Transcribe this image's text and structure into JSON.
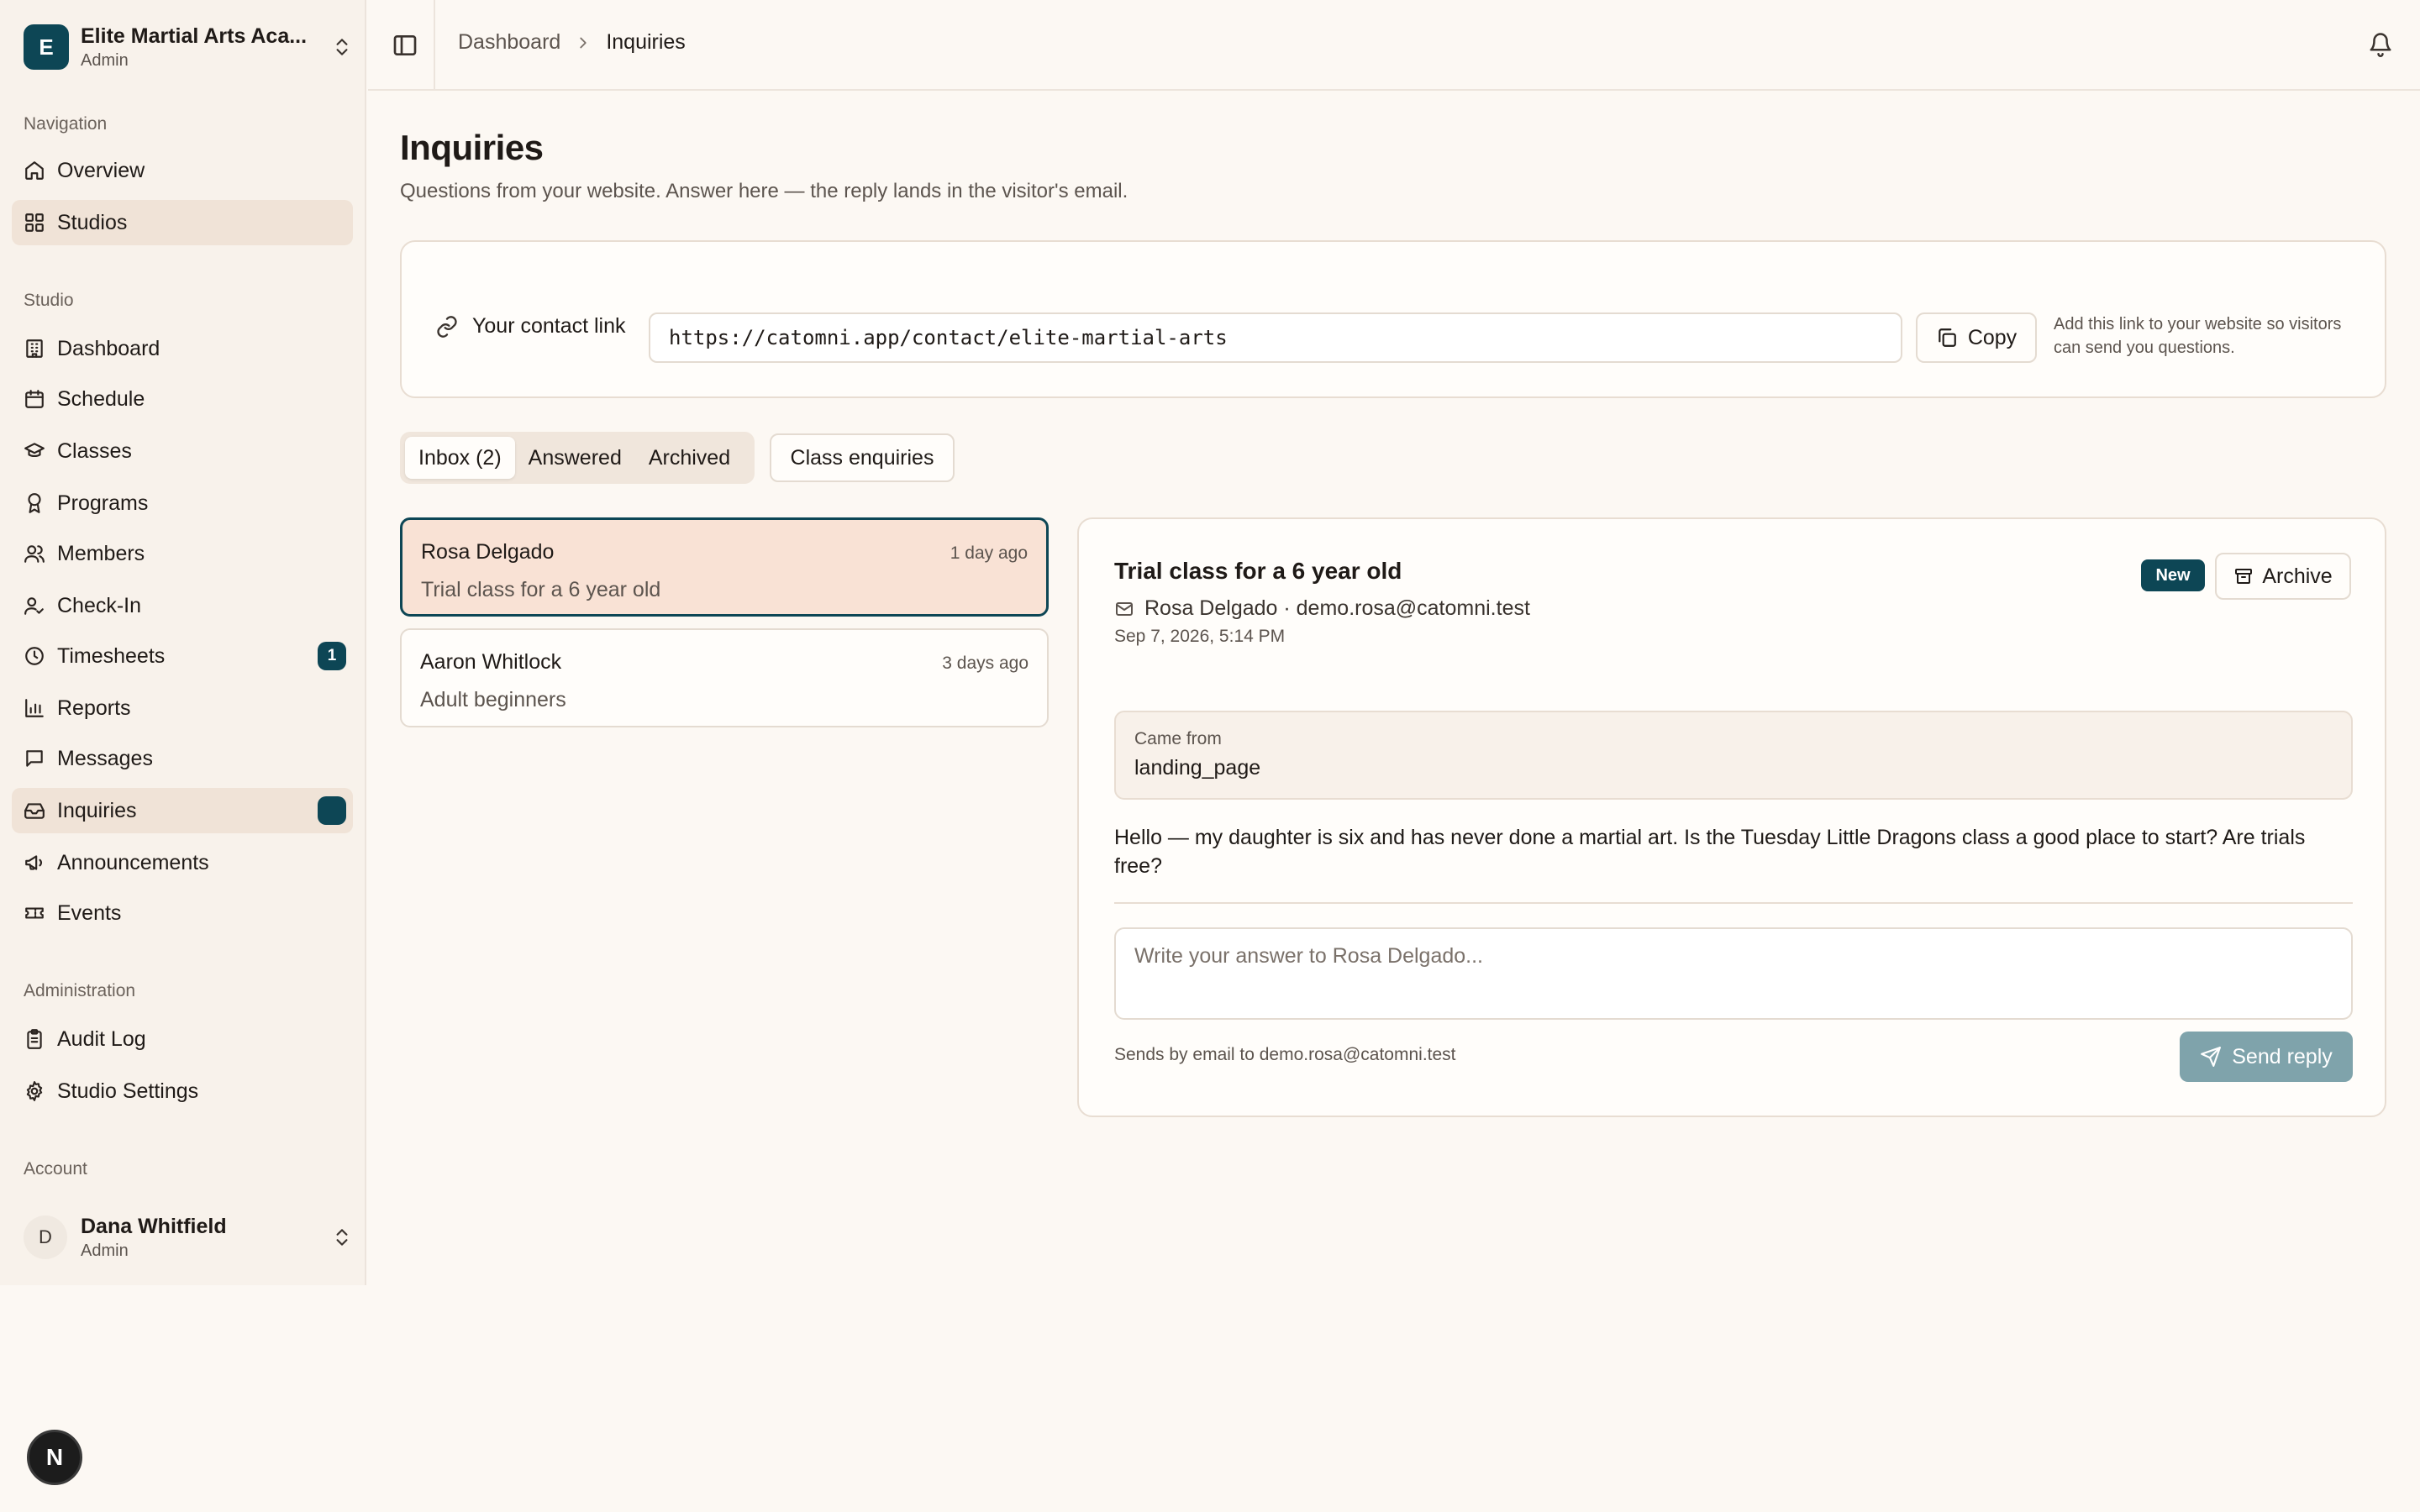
{
  "workspace": {
    "initial": "E",
    "name": "Elite Martial Arts Aca...",
    "role": "Admin"
  },
  "nav": {
    "section_navigation": "Navigation",
    "section_studio": "Studio",
    "section_administration": "Administration",
    "section_account": "Account",
    "items": [
      {
        "label": "Overview",
        "icon": "home-icon"
      },
      {
        "label": "Studios",
        "icon": "grid-icon"
      },
      {
        "label": "Dashboard",
        "icon": "building-icon"
      },
      {
        "label": "Schedule",
        "icon": "calendar-icon"
      },
      {
        "label": "Classes",
        "icon": "graduation-cap-icon"
      },
      {
        "label": "Programs",
        "icon": "award-icon"
      },
      {
        "label": "Members",
        "icon": "users-icon"
      },
      {
        "label": "Check-In",
        "icon": "user-check-icon"
      },
      {
        "label": "Timesheets",
        "icon": "clock-icon",
        "badge": "1"
      },
      {
        "label": "Reports",
        "icon": "bar-chart-icon"
      },
      {
        "label": "Messages",
        "icon": "message-icon"
      },
      {
        "label": "Inquiries",
        "icon": "inbox-icon",
        "badge": ""
      },
      {
        "label": "Announcements",
        "icon": "megaphone-icon"
      },
      {
        "label": "Events",
        "icon": "ticket-icon"
      },
      {
        "label": "Audit Log",
        "icon": "clipboard-icon"
      },
      {
        "label": "Studio Settings",
        "icon": "gear-icon"
      }
    ]
  },
  "account": {
    "initial": "D",
    "name": "Dana Whitfield",
    "role": "Admin"
  },
  "dev_badge": "N",
  "breadcrumb": {
    "parent": "Dashboard",
    "current": "Inquiries"
  },
  "page": {
    "title": "Inquiries",
    "subtitle": "Questions from your website. Answer here — the reply lands in the visitor's email."
  },
  "contact_link": {
    "label": "Your contact link",
    "url": "https://catomni.app/contact/elite-martial-arts",
    "copy_label": "Copy",
    "hint": "Add this link to your website so visitors can send you questions."
  },
  "tabs": [
    "Inbox (2)",
    "Answered",
    "Archived"
  ],
  "class_enquiries_label": "Class enquiries",
  "inquiries": [
    {
      "name": "Rosa Delgado",
      "time": "1 day ago",
      "subject": "Trial class for a 6 year old"
    },
    {
      "name": "Aaron Whitlock",
      "time": "3 days ago",
      "subject": "Adult beginners"
    }
  ],
  "detail": {
    "title": "Trial class for a 6 year old",
    "from": "Rosa Delgado · demo.rosa@catomni.test",
    "date": "Sep 7, 2026, 5:14 PM",
    "status": "New",
    "archive_label": "Archive",
    "source_label": "Came from",
    "source_value": "landing_page",
    "message": "Hello — my daughter is six and has never done a martial art. Is the Tuesday Little Dragons class a good place to start? Are trials free?",
    "reply_placeholder": "Write your answer to Rosa Delgado...",
    "reply_hint": "Sends by email to demo.rosa@catomni.test",
    "send_label": "Send reply"
  },
  "colors": {
    "accent": "#0d4655",
    "selected_bg": "#f9e2d5",
    "active_nav": "#f0e3d7",
    "send_disabled": "#7fa3ab"
  }
}
